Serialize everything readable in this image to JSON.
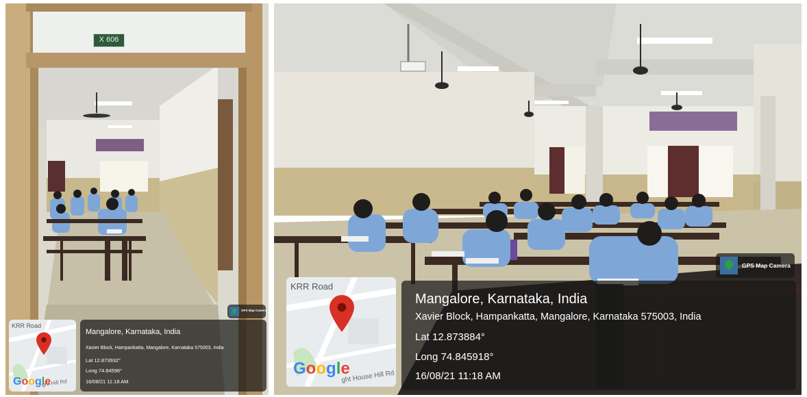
{
  "left_photo": {
    "room_sign": "X 606",
    "map": {
      "road_label": "KRR Road",
      "road_label_2": "ght Hill Rd",
      "logo": [
        "G",
        "o",
        "o",
        "g",
        "l",
        "e"
      ]
    },
    "app_name": "GPS Map Camera",
    "location": {
      "title": "Mangalore, Karnataka, India",
      "address": "Xavier Block, Hampankatta, Mangalore, Karnataka 575003, India",
      "lat": "Lat 12.873932°",
      "long": "Long 74.84596°",
      "datetime": "16/08/21 11:18 AM"
    }
  },
  "right_photo": {
    "map": {
      "road_label": "KRR Road",
      "road_label_2": "ght House Hill Rd",
      "logo": [
        "G",
        "o",
        "o",
        "g",
        "l",
        "e"
      ]
    },
    "app_name": "GPS Map Camera",
    "location": {
      "title": "Mangalore, Karnataka, India",
      "address": "Xavier Block, Hampankatta, Mangalore, Karnataka 575003, India",
      "lat": "Lat 12.873884°",
      "long": "Long 74.845918°",
      "datetime": "16/08/21 11:18 AM"
    }
  },
  "colors": {
    "pin": "#d93025",
    "uniform": "#7ea7d8",
    "desk": "#3b2a22",
    "wall": "#e7e5dc",
    "wainscot": "#c9b98c"
  }
}
